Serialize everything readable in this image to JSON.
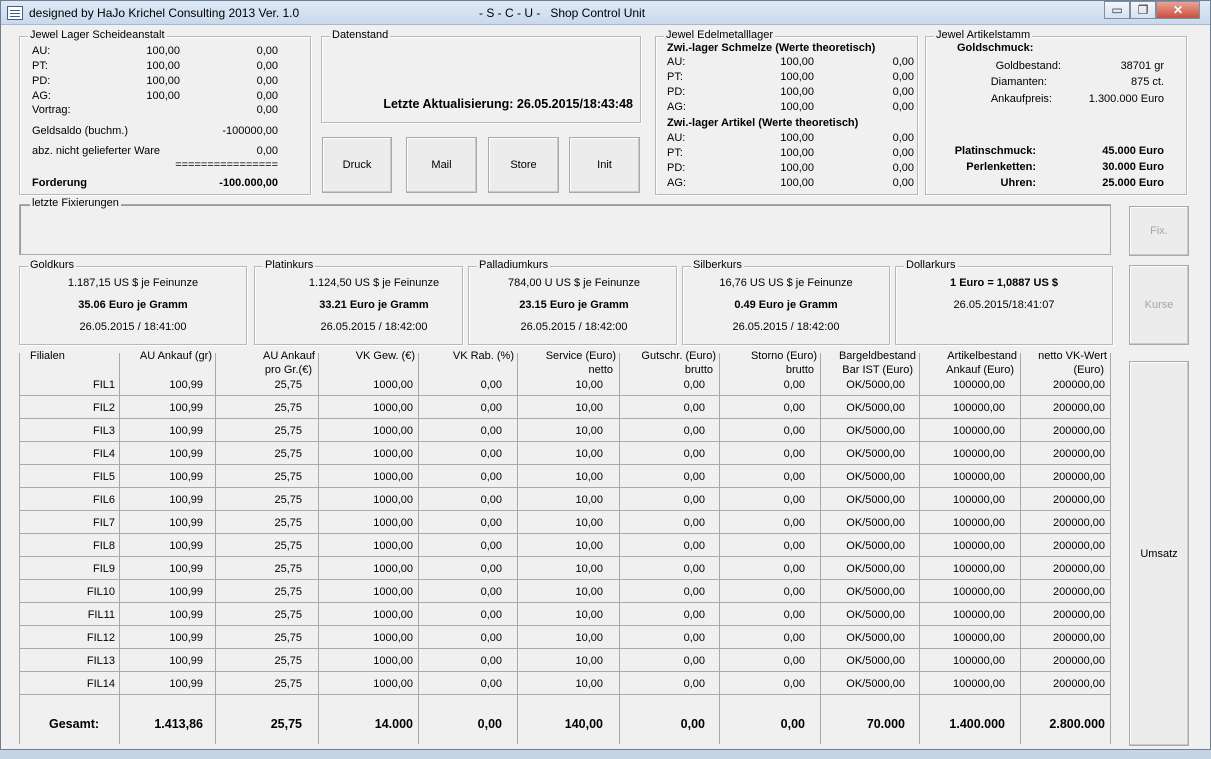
{
  "window": {
    "title_left": "designed by HaJo Krichel Consulting 2013 Ver. 1.0",
    "title_center": "- S - C - U -   Shop Control Unit",
    "minimize": "▭",
    "restore": "❐",
    "close": "✕"
  },
  "scheide": {
    "legend": "Jewel Lager Scheideanstalt",
    "rows": [
      {
        "label": "AU:",
        "v1": "100,00",
        "v2": "0,00"
      },
      {
        "label": "PT:",
        "v1": "100,00",
        "v2": "0,00"
      },
      {
        "label": "PD:",
        "v1": "100,00",
        "v2": "0,00"
      },
      {
        "label": "AG:",
        "v1": "100,00",
        "v2": "0,00"
      }
    ],
    "vortrag_label": "Vortrag:",
    "vortrag_value": "0,00",
    "geldsaldo_label": "Geldsaldo (buchm.)",
    "geldsaldo_value": "-100000,00",
    "abz_label": "abz. nicht gelieferter Ware",
    "abz_value": "0,00",
    "separator": "================",
    "forderung_label": "Forderung",
    "forderung_value": "-100.000,00"
  },
  "datenstand": {
    "legend": "Datenstand",
    "text": "Letzte Aktualisierung: 26.05.2015/18:43:48"
  },
  "buttons": {
    "druck": "Druck",
    "mail": "Mail",
    "store": "Store",
    "init": "Init",
    "fix": "Fix.",
    "kurse": "Kurse",
    "umsatz": "Umsatz"
  },
  "edelmetall": {
    "legend": "Jewel Edelmetalllager",
    "schmelze_title": "Zwi.-lager Schmelze (Werte theoretisch)",
    "schmelze_rows": [
      {
        "label": "AU:",
        "v1": "100,00",
        "v2": "0,00"
      },
      {
        "label": "PT:",
        "v1": "100,00",
        "v2": "0,00"
      },
      {
        "label": "PD:",
        "v1": "100,00",
        "v2": "0,00"
      },
      {
        "label": "AG:",
        "v1": "100,00",
        "v2": "0,00"
      }
    ],
    "artikel_title": "Zwi.-lager Artikel (Werte theoretisch)",
    "artikel_rows": [
      {
        "label": "AU:",
        "v1": "100,00",
        "v2": "0,00"
      },
      {
        "label": "PT:",
        "v1": "100,00",
        "v2": "0,00"
      },
      {
        "label": "PD:",
        "v1": "100,00",
        "v2": "0,00"
      },
      {
        "label": "AG:",
        "v1": "100,00",
        "v2": "0,00"
      }
    ]
  },
  "artikelstamm": {
    "legend": "Jewel Artikelstamm",
    "goldschmuck": "Goldschmuck:",
    "goldbestand_label": "Goldbestand:",
    "goldbestand_value": "38701 gr",
    "diamanten_label": "Diamanten:",
    "diamanten_value": "875 ct.",
    "ankaufpreis_label": "Ankaufpreis:",
    "ankaufpreis_value": "1.300.000 Euro",
    "platin_label": "Platinschmuck:",
    "platin_value": "45.000 Euro",
    "perlen_label": "Perlenketten:",
    "perlen_value": "30.000 Euro",
    "uhren_label": "Uhren:",
    "uhren_value": "25.000 Euro"
  },
  "fixierungen": {
    "legend": "letzte Fixierungen"
  },
  "kurse": [
    {
      "legend": "Goldkurs",
      "line1": "1.187,15 US $ je Feinunze",
      "line2": "35.06 Euro je Gramm",
      "line3": "26.05.2015 / 18:41:00"
    },
    {
      "legend": "Platinkurs",
      "line1": "1.124,50 US $ je Feinunze",
      "line2": "33.21 Euro je Gramm",
      "line3": "26.05.2015 / 18:42:00"
    },
    {
      "legend": "Palladiumkurs",
      "line1": "784,00 U US $ je Feinunze",
      "line2": "23.15 Euro je Gramm",
      "line3": "26.05.2015 / 18:42:00"
    },
    {
      "legend": "Silberkurs",
      "line1": "16,76 US US $ je Feinunze",
      "line2": "0.49 Euro je Gramm",
      "line3": "26.05.2015 / 18:42:00"
    },
    {
      "legend": "Dollarkurs",
      "line1": "1 Euro = 1,0887 US $",
      "line2": "",
      "line3": "26.05.2015/18:41:07"
    }
  ],
  "table": {
    "headers": [
      {
        "h1": "Filialen",
        "h2": ""
      },
      {
        "h1": "AU Ankauf (gr)",
        "h2": ""
      },
      {
        "h1": "AU Ankauf",
        "h2": "pro Gr.(€)"
      },
      {
        "h1": "VK Gew. (€)",
        "h2": ""
      },
      {
        "h1": "VK Rab. (%)",
        "h2": ""
      },
      {
        "h1": "Service (Euro)",
        "h2": "netto"
      },
      {
        "h1": "Gutschr. (Euro)",
        "h2": "brutto"
      },
      {
        "h1": "Storno (Euro)",
        "h2": "brutto"
      },
      {
        "h1": "Bargeldbestand",
        "h2": "Bar IST (Euro)"
      },
      {
        "h1": "Artikelbestand",
        "h2": "Ankauf (Euro)"
      },
      {
        "h1": "netto VK-Wert",
        "h2": "(Euro)"
      }
    ],
    "rows": [
      [
        "FIL1",
        "100,99",
        "25,75",
        "1000,00",
        "0,00",
        "10,00",
        "0,00",
        "0,00",
        "OK/5000,00",
        "100000,00",
        "200000,00"
      ],
      [
        "FIL2",
        "100,99",
        "25,75",
        "1000,00",
        "0,00",
        "10,00",
        "0,00",
        "0,00",
        "OK/5000,00",
        "100000,00",
        "200000,00"
      ],
      [
        "FIL3",
        "100,99",
        "25,75",
        "1000,00",
        "0,00",
        "10,00",
        "0,00",
        "0,00",
        "OK/5000,00",
        "100000,00",
        "200000,00"
      ],
      [
        "FIL4",
        "100,99",
        "25,75",
        "1000,00",
        "0,00",
        "10,00",
        "0,00",
        "0,00",
        "OK/5000,00",
        "100000,00",
        "200000,00"
      ],
      [
        "FIL5",
        "100,99",
        "25,75",
        "1000,00",
        "0,00",
        "10,00",
        "0,00",
        "0,00",
        "OK/5000,00",
        "100000,00",
        "200000,00"
      ],
      [
        "FIL6",
        "100,99",
        "25,75",
        "1000,00",
        "0,00",
        "10,00",
        "0,00",
        "0,00",
        "OK/5000,00",
        "100000,00",
        "200000,00"
      ],
      [
        "FIL7",
        "100,99",
        "25,75",
        "1000,00",
        "0,00",
        "10,00",
        "0,00",
        "0,00",
        "OK/5000,00",
        "100000,00",
        "200000,00"
      ],
      [
        "FIL8",
        "100,99",
        "25,75",
        "1000,00",
        "0,00",
        "10,00",
        "0,00",
        "0,00",
        "OK/5000,00",
        "100000,00",
        "200000,00"
      ],
      [
        "FIL9",
        "100,99",
        "25,75",
        "1000,00",
        "0,00",
        "10,00",
        "0,00",
        "0,00",
        "OK/5000,00",
        "100000,00",
        "200000,00"
      ],
      [
        "FIL10",
        "100,99",
        "25,75",
        "1000,00",
        "0,00",
        "10,00",
        "0,00",
        "0,00",
        "OK/5000,00",
        "100000,00",
        "200000,00"
      ],
      [
        "FIL11",
        "100,99",
        "25,75",
        "1000,00",
        "0,00",
        "10,00",
        "0,00",
        "0,00",
        "OK/5000,00",
        "100000,00",
        "200000,00"
      ],
      [
        "FIL12",
        "100,99",
        "25,75",
        "1000,00",
        "0,00",
        "10,00",
        "0,00",
        "0,00",
        "OK/5000,00",
        "100000,00",
        "200000,00"
      ],
      [
        "FIL13",
        "100,99",
        "25,75",
        "1000,00",
        "0,00",
        "10,00",
        "0,00",
        "0,00",
        "OK/5000,00",
        "100000,00",
        "200000,00"
      ],
      [
        "FIL14",
        "100,99",
        "25,75",
        "1000,00",
        "0,00",
        "10,00",
        "0,00",
        "0,00",
        "OK/5000,00",
        "100000,00",
        "200000,00"
      ]
    ],
    "totals": [
      "Gesamt:",
      "1.413,86",
      "25,75",
      "14.000",
      "0,00",
      "140,00",
      "0,00",
      "0,00",
      "70.000",
      "1.400.000",
      "2.800.000"
    ]
  }
}
